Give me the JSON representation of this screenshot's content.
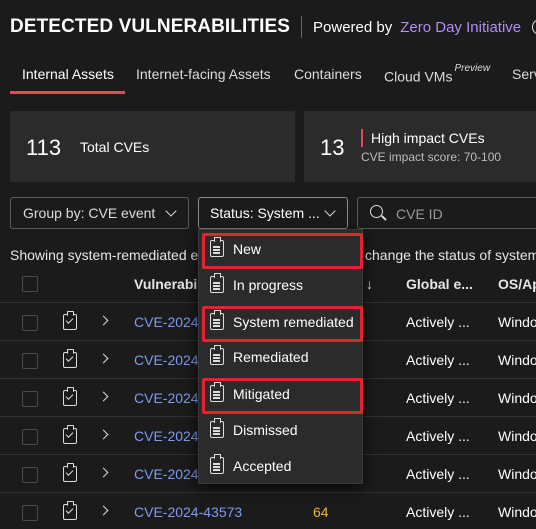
{
  "header": {
    "title": "DETECTED VULNERABILITIES",
    "powered_by": "Powered by",
    "partner": "Zero Day Initiative",
    "info_glyph": "i",
    "partner_color": "#b48cf2"
  },
  "tabs": [
    {
      "label": "Internal Assets",
      "active": true
    },
    {
      "label": "Internet-facing Assets"
    },
    {
      "label": "Containers"
    },
    {
      "label": "Cloud VMs",
      "badge": "Preview"
    },
    {
      "label": "Serv"
    }
  ],
  "accent_color": "#e74856",
  "cards": {
    "total": {
      "count": "113",
      "label": "Total CVEs"
    },
    "high": {
      "count": "13",
      "label": "High impact CVEs",
      "sub": "CVE impact score: 70-100"
    }
  },
  "filters": {
    "group_by": "Group by: CVE event",
    "status": "Status: System ...",
    "search_placeholder": "CVE ID"
  },
  "showing_text_left": "Showing system-remediated e",
  "showing_text_right": "change the status of system",
  "table": {
    "headers": {
      "vulnerability": "Vulnerabili",
      "sort_glyph": "↓",
      "global": "Global e...",
      "os": "OS/Ap"
    },
    "rows": [
      {
        "cve": "CVE-2024-",
        "global": "Actively ...",
        "os": "Windo"
      },
      {
        "cve": "CVE-2024-",
        "global": "Actively ...",
        "os": "Windo"
      },
      {
        "cve": "CVE-2024-",
        "global": "Actively ...",
        "os": "Windo"
      },
      {
        "cve": "CVE-2024-",
        "global": "Actively ...",
        "os": "Windo"
      },
      {
        "cve": "CVE-2024-",
        "global": "Actively ...",
        "os": "Windo"
      },
      {
        "cve": "CVE-2024-43573",
        "impact": "64",
        "global": "Actively ...",
        "os": "Windo"
      }
    ]
  },
  "status_dropdown": {
    "options": [
      {
        "label": "New",
        "icon": "clipboard-icon",
        "highlighted": true
      },
      {
        "label": "In progress",
        "icon": "clipboard-icon"
      },
      {
        "label": "System remediated",
        "icon": "clipboard-check-icon",
        "highlighted": true
      },
      {
        "label": "Remediated",
        "icon": "clipboard-check-icon"
      },
      {
        "label": "Mitigated",
        "icon": "clipboard-shield-icon",
        "highlighted": true
      },
      {
        "label": "Dismissed",
        "icon": "clipboard-x-icon"
      },
      {
        "label": "Accepted",
        "icon": "clipboard-clock-icon"
      }
    ],
    "highlight_color": "#e1242f"
  }
}
